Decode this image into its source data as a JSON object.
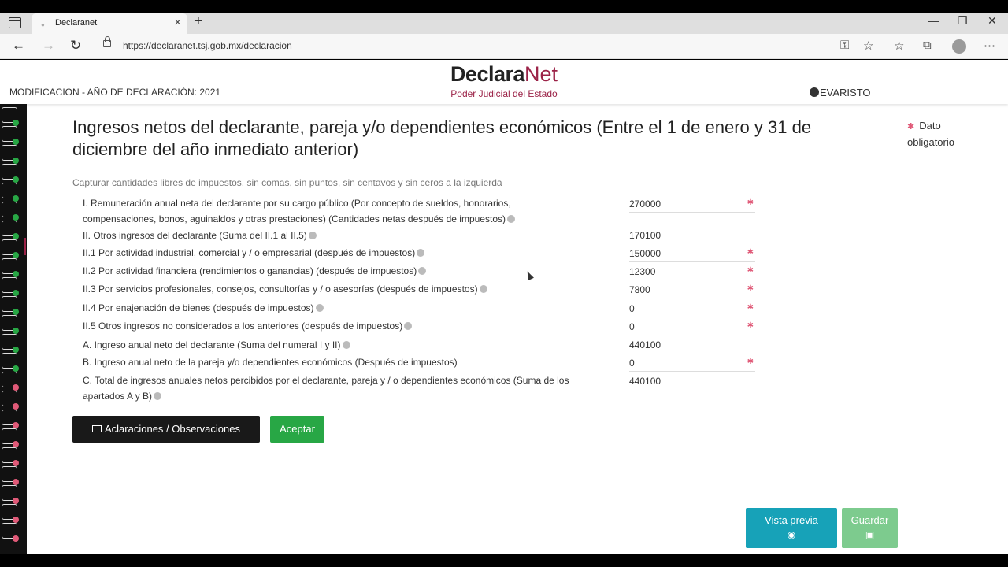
{
  "browser": {
    "tab_title": "Declaranet",
    "url": "https://declaranet.tsj.gob.mx/declaracion"
  },
  "header": {
    "declaration_info": "MODIFICACION - AÑO DE DECLARACIÓN: 2021",
    "brand_part1": "Declara",
    "brand_part2": "Net",
    "brand_subtitle": "Poder Judicial del Estado",
    "user_name": "EVARISTO"
  },
  "main": {
    "title": "Ingresos netos del declarante, pareja y/o dependientes económicos (Entre el 1 de enero y 31 de diciembre del año inmediato anterior)",
    "required_note": "Dato obligatorio",
    "instructions": "Capturar cantidades libres de impuestos, sin comas, sin puntos, sin centavos y sin ceros a la izquierda",
    "rows": [
      {
        "label": "I. Remuneración anual neta del declarante por su cargo público (Por concepto de sueldos, honorarios, compensaciones, bonos, aguinaldos y otras prestaciones) (Cantidades netas después de impuestos)",
        "value": "270000"
      },
      {
        "label": "II. Otros ingresos del declarante (Suma del II.1 al II.5)",
        "value": "170100"
      },
      {
        "label": "II.1 Por actividad industrial, comercial y / o empresarial (después de impuestos)",
        "value": "150000"
      },
      {
        "label": "II.2 Por actividad financiera (rendimientos o ganancias) (después de impuestos)",
        "value": "12300"
      },
      {
        "label": "II.3 Por servicios profesionales, consejos, consultorías y / o asesorías (después de impuestos)",
        "value": "7800"
      },
      {
        "label": "II.4 Por enajenación de bienes (después de impuestos)",
        "value": "0"
      },
      {
        "label": "II.5 Otros ingresos no considerados a los anteriores (después de impuestos)",
        "value": "0"
      },
      {
        "label": "A. Ingreso anual neto del declarante (Suma del numeral I y II)",
        "value": "440100"
      },
      {
        "label": "B. Ingreso anual neto de la pareja y/o dependientes económicos (Después de impuestos)",
        "value": "0"
      },
      {
        "label": "C. Total de ingresos anuales netos percibidos por el declarante, pareja y / o dependientes económicos (Suma de los apartados A y B)",
        "value": "440100"
      }
    ]
  },
  "buttons": {
    "aclaraciones": "Aclaraciones / Observaciones",
    "aceptar": "Aceptar",
    "vista_previa": "Vista previa",
    "guardar": "Guardar"
  },
  "icons": {
    "required_marker": "asterisk-icon",
    "info": "info-icon",
    "mail": "mail-icon",
    "eye": "eye-icon",
    "save": "save-icon"
  },
  "colors": {
    "brand": "#9b2247",
    "accept": "#28a745",
    "preview": "#17a2b8",
    "save_disabled": "#7dcb8e"
  }
}
